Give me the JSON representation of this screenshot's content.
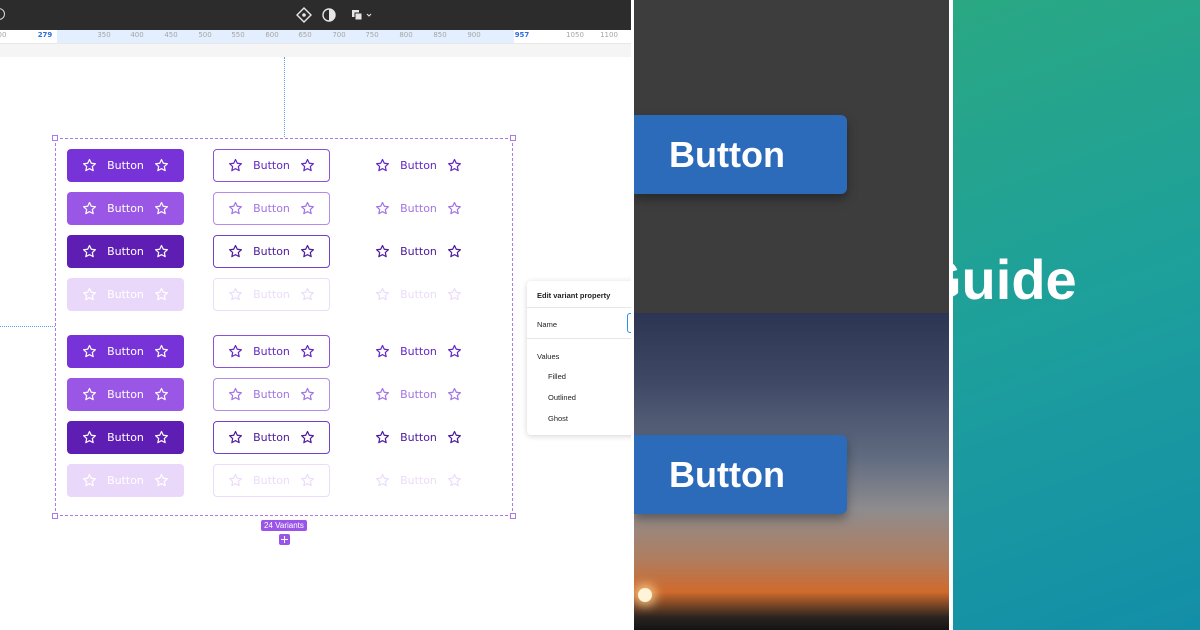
{
  "editor": {
    "ruler_ticks": [
      "00",
      "279",
      "350",
      "400",
      "450",
      "500",
      "550",
      "600",
      "650",
      "700",
      "750",
      "800",
      "850",
      "900",
      "957",
      "1050",
      "1100"
    ],
    "highlighted_ticks": [
      "279",
      "957"
    ],
    "button_label": "Button",
    "button_icon": "star-icon",
    "variant_colors": {
      "filled_default": "#7733d8",
      "filled_hover": "#9a57e6",
      "filled_pressed": "#5e1eb4",
      "filled_disabled": "#ead8fb"
    },
    "variants_badge": "24 Variants",
    "property_panel": {
      "title": "Edit variant property",
      "name_label": "Name",
      "values_label": "Values",
      "values": [
        "Filled",
        "Outlined",
        "Ghost"
      ]
    }
  },
  "showcase": {
    "top_button_label": "Button",
    "bottom_button_label": "Button",
    "button_color": "#2c6bb9"
  },
  "hero": {
    "title": "Guide"
  }
}
